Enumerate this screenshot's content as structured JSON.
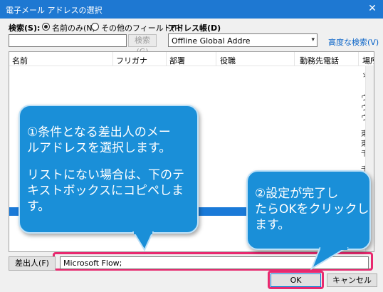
{
  "window": {
    "title": "電子メール アドレスの選択",
    "close_glyph": "✕"
  },
  "search": {
    "label": "検索(S):",
    "option_name_only": "名前のみ(N)",
    "option_other_fields": "その他のフィールド(R)",
    "input_value": "",
    "search_button": "検索(G)"
  },
  "addressbook": {
    "label": "アドレス帳(D)",
    "selected": "Offline Global Addre",
    "advanced_search": "高度な検索(V)"
  },
  "list": {
    "columns": [
      "名前",
      "フリガナ",
      "部署",
      "役職",
      "勤務先電話",
      "場所"
    ],
    "right_edge_chars": [
      "ゞ",
      "ウ",
      "ウ",
      "ウ",
      "東",
      "東",
      "千",
      "千"
    ]
  },
  "callouts": {
    "left": {
      "line1": "①条件となる差出人のメー",
      "line2": "ルアドレスを選択します。",
      "line3": "リストにない場合は、下のテ",
      "line4": "キストボックスにコピペしま",
      "line5": "す。"
    },
    "right": {
      "line1": "②設定が完了し",
      "line2": "たらOKをクリックし",
      "line3": "ます。"
    }
  },
  "from": {
    "button": "差出人(F)",
    "value": "Microsoft Flow;"
  },
  "footer": {
    "ok": "OK",
    "cancel": "キャンセル"
  },
  "colors": {
    "titlebar": "#1e78d2",
    "callout": "#1a8fd8",
    "highlight": "#e8296f",
    "link": "#0a64c8"
  }
}
